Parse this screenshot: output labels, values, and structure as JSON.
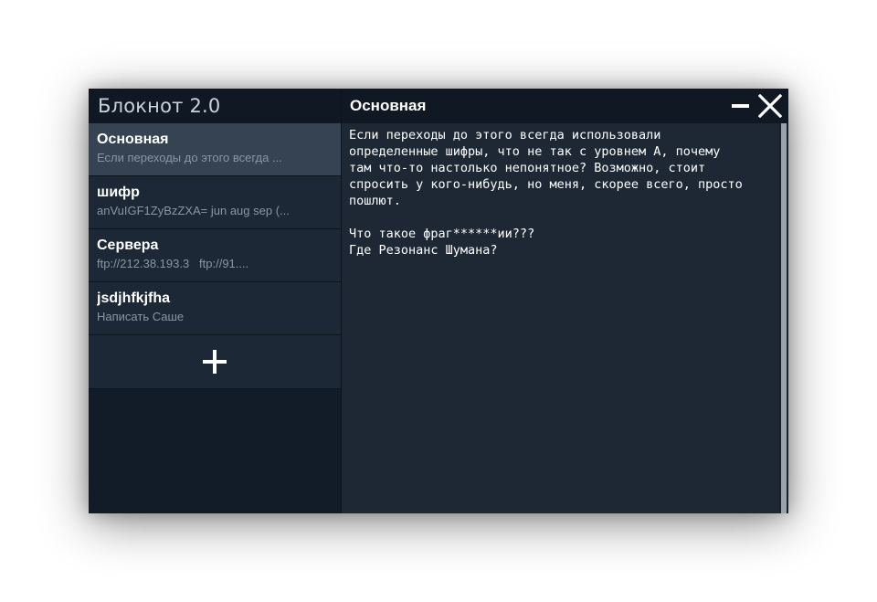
{
  "app": {
    "title": "Блокнот 2.0"
  },
  "sidebar": {
    "notes": [
      {
        "title": "Основная",
        "preview": "Если переходы до этого всегда ...",
        "active": true
      },
      {
        "title": "шифр",
        "preview": "anVuIGF1ZyBzZXA= jun aug sep (...",
        "active": false
      },
      {
        "title": "Сервера",
        "preview": "ftp://212.38.193.3   ftp://91....",
        "active": false
      },
      {
        "title": "jsdjhfkjfha",
        "preview": "Написать Саше",
        "active": false
      }
    ],
    "add_icon": "plus-icon"
  },
  "editor": {
    "heading": "Основная",
    "content": "Если переходы до этого всегда использовали\nопределенные шифры, что не так с уровнем А, почему\nтам что-то настолько непонятное? Возможно, стоит\nспросить у кого-нибудь, но меня, скорее всего, просто\nпошлют.\n\nЧто такое фраг******ии???\nГде Резонанс Шумана?"
  },
  "window_controls": {
    "minimize_icon": "minimize-icon",
    "close_icon": "close-icon"
  },
  "colors": {
    "sidebar_bg": "#111c28",
    "item_bg": "#1c2836",
    "active_item_bg": "#364352",
    "editor_bg": "#1d2834",
    "header_bg": "#0f1823",
    "text": "#ffffff",
    "muted_text": "#8a96a3"
  }
}
